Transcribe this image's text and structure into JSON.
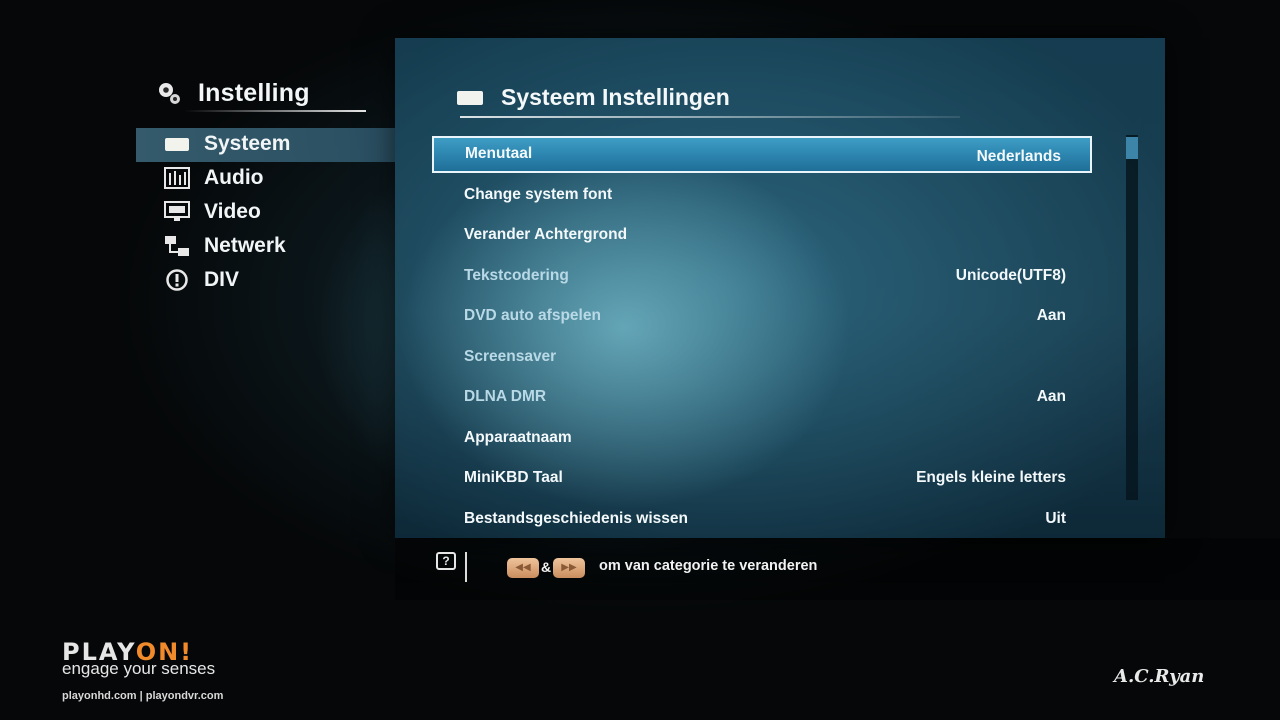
{
  "left_menu": {
    "title": "Instelling",
    "items": [
      {
        "label": "Systeem",
        "icon": "system-card-icon",
        "active": true
      },
      {
        "label": "Audio",
        "icon": "audio-equalizer-icon",
        "active": false
      },
      {
        "label": "Video",
        "icon": "video-monitor-icon",
        "active": false
      },
      {
        "label": "Netwerk",
        "icon": "network-icon",
        "active": false
      },
      {
        "label": "DIV",
        "icon": "info-circle-icon",
        "active": false
      }
    ]
  },
  "panel": {
    "title": "Systeem Instellingen",
    "settings": [
      {
        "label": "Menutaal",
        "value": "Nederlands",
        "selected": true
      },
      {
        "label": "Change system font",
        "value": ""
      },
      {
        "label": "Verander Achtergrond",
        "value": ""
      },
      {
        "label": "Tekstcodering",
        "value": "Unicode(UTF8)"
      },
      {
        "label": "DVD auto afspelen",
        "value": "Aan"
      },
      {
        "label": "Screensaver",
        "value": ""
      },
      {
        "label": "DLNA DMR",
        "value": "Aan"
      },
      {
        "label": "Apparaatnaam",
        "value": ""
      },
      {
        "label": "MiniKBD Taal",
        "value": "Engels kleine letters"
      },
      {
        "label": "Bestandsgeschiedenis wissen",
        "value": "Uit"
      }
    ]
  },
  "help": {
    "ampersand": "&",
    "text": "om van categorie te veranderen",
    "help_icon_glyph": "?"
  },
  "branding": {
    "logo_part1": "PLAY",
    "logo_part2": "ON!",
    "tagline": "engage your senses",
    "urls": "playonhd.com | playondvr.com",
    "maker": "A.C.Ryan"
  },
  "colors": {
    "accent_selection": "#2d86b0",
    "logo_accent": "#f08a2a",
    "button_orange": "#e0a878"
  }
}
